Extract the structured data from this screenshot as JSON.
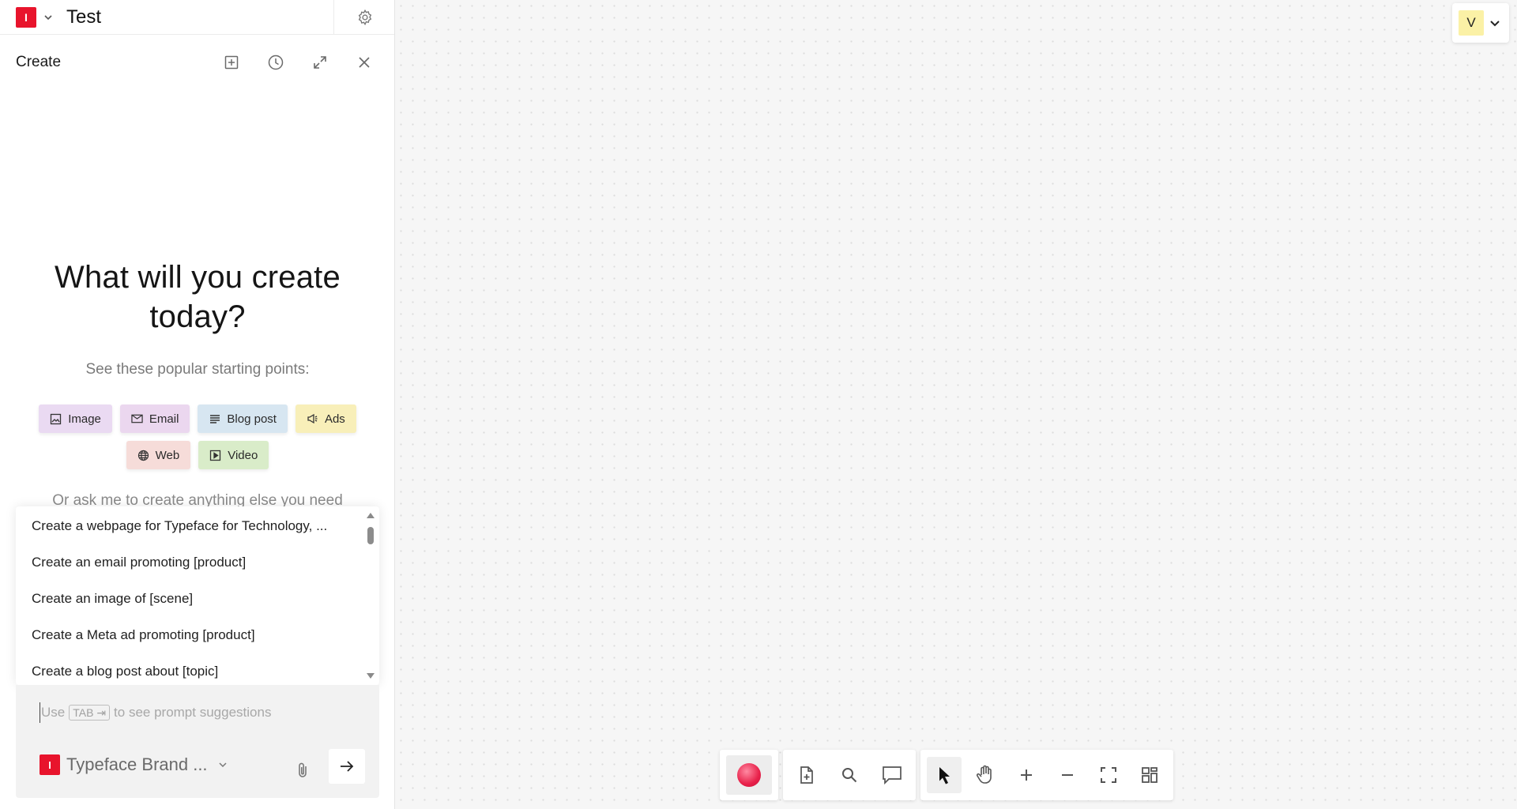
{
  "app": {
    "logo_letter": "I",
    "title": "Test"
  },
  "panel": {
    "title": "Create",
    "hero_line1": "What will you create",
    "hero_line2": "today?",
    "subtitle": "See these popular starting points:",
    "chips": [
      {
        "label": "Image",
        "icon": "image-icon"
      },
      {
        "label": "Email",
        "icon": "mail-icon"
      },
      {
        "label": "Blog post",
        "icon": "text-lines-icon"
      },
      {
        "label": "Ads",
        "icon": "megaphone-icon"
      },
      {
        "label": "Web",
        "icon": "globe-icon"
      },
      {
        "label": "Video",
        "icon": "play-icon"
      }
    ],
    "ask_text": "Or ask me to create anything else you need",
    "suggestions": [
      "Create a webpage for Typeface for Technology, ...",
      "Create an email promoting [product]",
      "Create an image of [scene]",
      "Create a Meta ad promoting [product]",
      "Create a blog post about [topic]"
    ],
    "composer": {
      "placeholder_pre": "Use",
      "tab_key": "TAB ⇥",
      "placeholder_post": "to see prompt suggestions",
      "brand_name": "Typeface Brand ..."
    }
  },
  "user": {
    "initial": "V"
  },
  "colors": {
    "brand_red": "#e8142c",
    "chip_image": "#eadaf2",
    "chip_email": "#ebd7ef",
    "chip_blog": "#d7e6f1",
    "chip_ads": "#f8efb9",
    "chip_web": "#f6dcd9",
    "chip_video": "#d9ecc9",
    "avatar_bg": "#fbf1a6"
  }
}
